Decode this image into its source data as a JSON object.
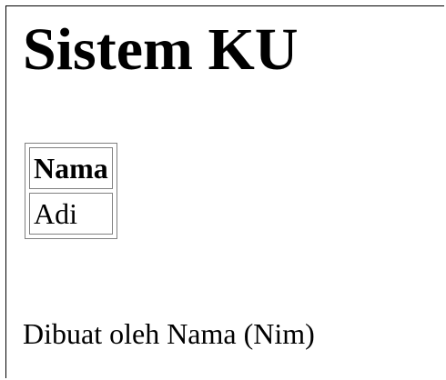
{
  "page": {
    "title": "Sistem KU"
  },
  "table": {
    "header": "Nama",
    "rows": [
      "Adi"
    ]
  },
  "footer": {
    "text": "Dibuat oleh Nama (Nim)"
  }
}
